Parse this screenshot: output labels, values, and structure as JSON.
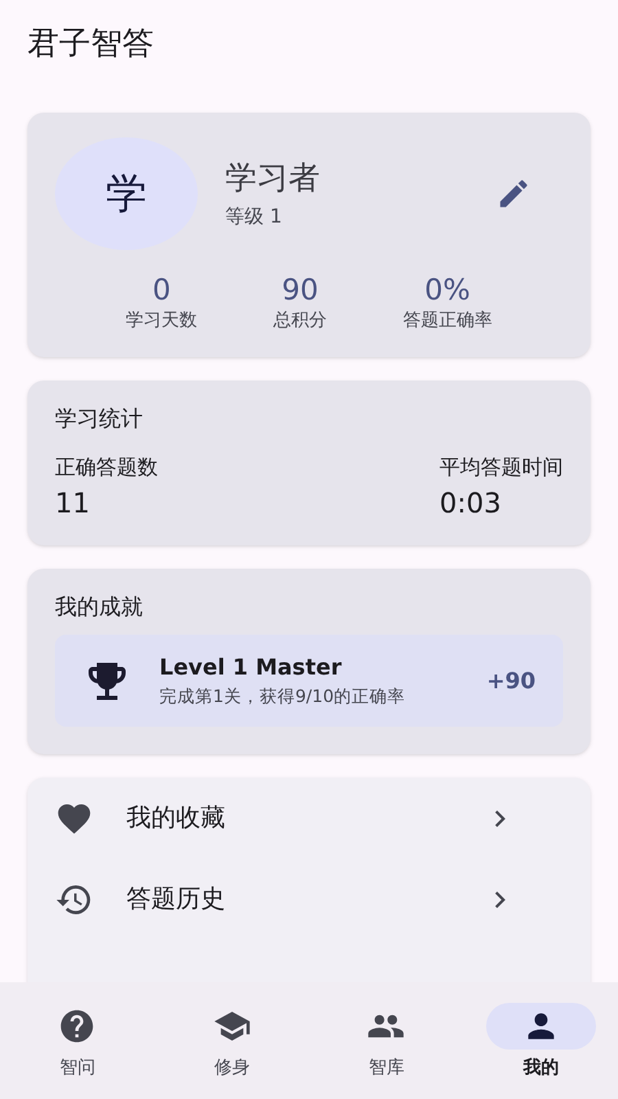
{
  "app_title": "君子智答",
  "profile": {
    "avatar_text": "学",
    "name": "学习者",
    "level": "等级 1",
    "stats": [
      {
        "value": "0",
        "label": "学习天数"
      },
      {
        "value": "90",
        "label": "总积分"
      },
      {
        "value": "0%",
        "label": "答题正确率"
      }
    ]
  },
  "study_stats": {
    "title": "学习统计",
    "items": [
      {
        "label": "正确答题数",
        "value": "11"
      },
      {
        "label": "平均答题时间",
        "value": "0:03"
      }
    ]
  },
  "achievements": {
    "title": "我的成就",
    "items": [
      {
        "title": "Level 1 Master",
        "description": "完成第1关，获得9/10的正确率",
        "points": "+90"
      }
    ]
  },
  "menu": [
    {
      "kind": "favorites",
      "label": "我的收藏"
    },
    {
      "kind": "history",
      "label": "答题历史"
    }
  ],
  "bottom_nav": [
    {
      "kind": "ask",
      "label": "智问",
      "selected": false
    },
    {
      "kind": "study",
      "label": "修身",
      "selected": false
    },
    {
      "kind": "library",
      "label": "智库",
      "selected": false
    },
    {
      "kind": "me",
      "label": "我的",
      "selected": true
    }
  ]
}
